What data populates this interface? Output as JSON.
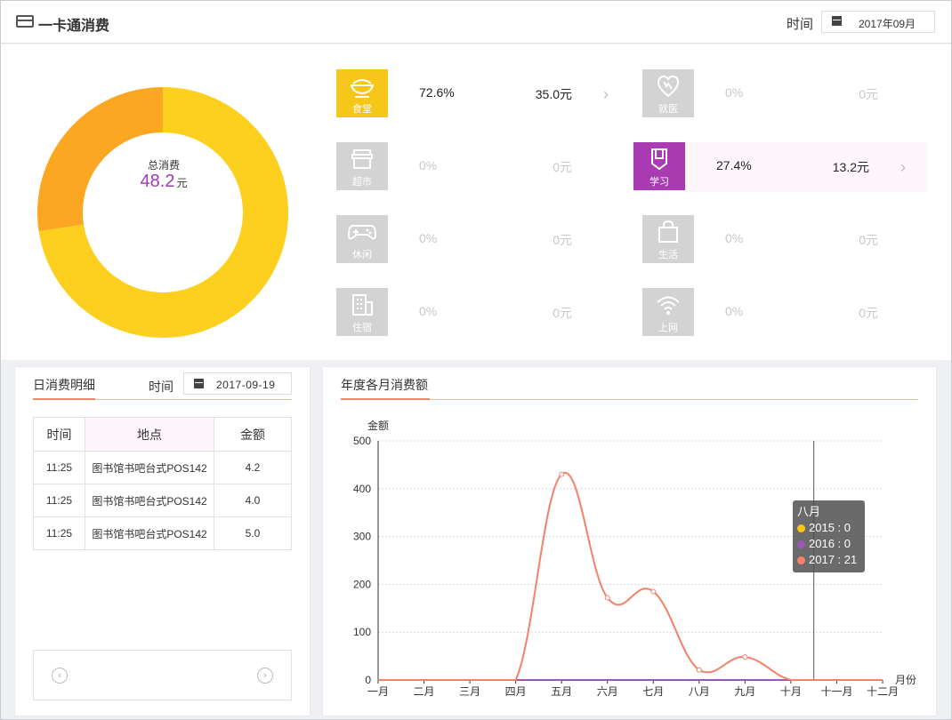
{
  "header": {
    "title": "一卡通消费",
    "time_label": "时间",
    "date": "2017年09月"
  },
  "summary": {
    "total_label": "总消费",
    "total_value": "48.2",
    "total_unit": "元",
    "colors": {
      "food": "#fdd01f",
      "study": "#fba721"
    },
    "shares": {
      "food": 0.726,
      "study": 0.274
    }
  },
  "categories": [
    {
      "key": "food",
      "label": "食堂",
      "icon": "bowl-icon",
      "pct": "72.6%",
      "amount": "35.0元",
      "active": true,
      "color": "#f6c719"
    },
    {
      "key": "medical",
      "label": "就医",
      "icon": "heart-icon",
      "pct": "0%",
      "amount": "0元",
      "active": false,
      "color": "#d3d3d3"
    },
    {
      "key": "market",
      "label": "超市",
      "icon": "store-icon",
      "pct": "0%",
      "amount": "0元",
      "active": false,
      "color": "#d3d3d3"
    },
    {
      "key": "study",
      "label": "学习",
      "icon": "bookmark-icon",
      "pct": "27.4%",
      "amount": "13.2元",
      "active": true,
      "color": "#a93cb3"
    },
    {
      "key": "leisure",
      "label": "休闲",
      "icon": "gamepad-icon",
      "pct": "0%",
      "amount": "0元",
      "active": false,
      "color": "#d3d3d3"
    },
    {
      "key": "life",
      "label": "生活",
      "icon": "bag-icon",
      "pct": "0%",
      "amount": "0元",
      "active": false,
      "color": "#d3d3d3"
    },
    {
      "key": "dorm",
      "label": "住宿",
      "icon": "building-icon",
      "pct": "0%",
      "amount": "0元",
      "active": false,
      "color": "#d3d3d3"
    },
    {
      "key": "internet",
      "label": "上网",
      "icon": "wifi-icon",
      "pct": "0%",
      "amount": "0元",
      "active": false,
      "color": "#d3d3d3"
    }
  ],
  "daily": {
    "title": "日消费明细",
    "time_label": "时间",
    "date": "2017-09-19",
    "columns": [
      "时间",
      "地点",
      "金额"
    ],
    "rows": [
      [
        "11:25",
        "图书馆书吧台式POS142",
        "4.2"
      ],
      [
        "11:25",
        "图书馆书吧台式POS142",
        "4.0"
      ],
      [
        "11:25",
        "图书馆书吧台式POS142",
        "5.0"
      ]
    ],
    "prev": "‹",
    "next": "›"
  },
  "monthly": {
    "title": "年度各月消费额",
    "tooltip": {
      "title": "八月",
      "rows": [
        {
          "label": "2015 : 0",
          "color": "#f6c719"
        },
        {
          "label": "2016 : 0",
          "color": "#9b59b6"
        },
        {
          "label": "2017 : 21",
          "color": "#f6806a"
        }
      ]
    }
  },
  "chart_data": {
    "type": "line",
    "xlabel": "月份",
    "ylabel": "金额",
    "ylim": [
      0,
      500
    ],
    "yticks": [
      0,
      100,
      200,
      300,
      400,
      500
    ],
    "categories": [
      "一月",
      "二月",
      "三月",
      "四月",
      "五月",
      "六月",
      "七月",
      "八月",
      "九月",
      "十月",
      "十一月",
      "十二月"
    ],
    "series": [
      {
        "name": "2015",
        "color": "#f6c719",
        "values": [
          0,
          0,
          0,
          0,
          0,
          0,
          0,
          0,
          0,
          0,
          0,
          0
        ]
      },
      {
        "name": "2016",
        "color": "#9b59b6",
        "values": [
          0,
          0,
          0,
          0,
          0,
          0,
          0,
          0,
          0,
          0,
          0,
          0
        ]
      },
      {
        "name": "2017",
        "color": "#f6806a",
        "values": [
          0,
          0,
          0,
          0,
          430,
          172,
          185,
          21,
          48,
          0,
          0,
          0
        ]
      }
    ],
    "grid": true,
    "highlight_category": "八月"
  }
}
